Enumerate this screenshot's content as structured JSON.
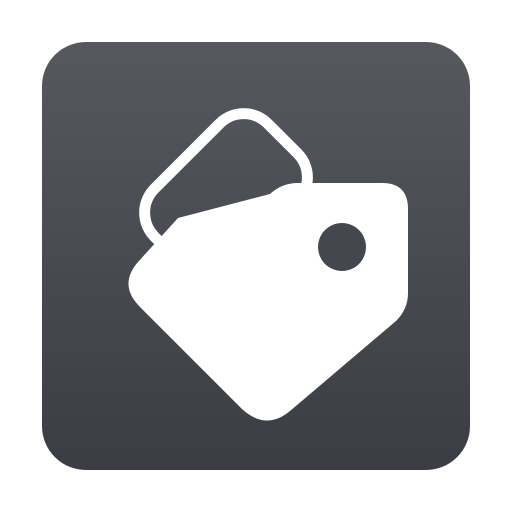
{
  "app_icon": {
    "icon": "price-tag-icon",
    "background_colors": [
      "#55595e",
      "#3a3e44"
    ],
    "foreground_color": "#ffffff",
    "tag_hole_color": "#44484e"
  }
}
